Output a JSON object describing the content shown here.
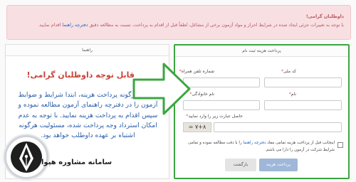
{
  "alert": {
    "title": "داوطلبان گرامی!",
    "text": "با توجه به تغییرات جزئی ایجاد شده در شرایط احراز و مواد آزمون برخی از مشاغل، لطفاً قبل از اقدام به پرداخت، نسبت به مطالعه دقیق",
    "link": "دفترچه راهنما",
    "text_end": "اقدام نمایید."
  },
  "guide_panel": {
    "header": "راهنما",
    "title": "قابل توجه داوطلبان گرامی!",
    "body": "قبل از هرگونه پرداخت هزینه، ابتدا شرایط و ضوابط آزمون را در دفترچه راهنمای آزمون مطالعه نموده و سپس اقدام به پرداخت هزینه نمایید. با توجه به عدم امکان استرداد وجه پرداخت شده، مسئولیت هرگونه اشتباه بر عهده داوطلب خواهد بود."
  },
  "payment_form": {
    "header": "پرداخت هزینه ثبت نام",
    "national_code_label": "کد ملی",
    "mobile_label": "شماره تلفن همراه",
    "first_name_label": "نام",
    "last_name_label": "نام خانوادگی",
    "captcha_label": "حاصل عبارت زیر را وارد نمایید",
    "captcha_text": "۷+۸ = ",
    "agreement_text_start": "اینجانب قبل از پرداخت هزینه تمامی مفاد",
    "agreement_link": "دفترچه راهنما",
    "agreement_text_end": "را با دقت مطالعه نموده و تمامی شرایط شرکت در آزمون را دارا می باشم.",
    "pay_button": "پرداخت هزینه",
    "back_button": "بازگشت"
  },
  "watermark": {
    "text": "سامانه مشاوره هپوا"
  },
  "colors": {
    "alert_bg": "#f8dfe2",
    "alert_text": "#b9545d",
    "highlight_border": "#3ca640",
    "guide_title": "#c8453b",
    "guide_body": "#2a5fab",
    "pay_button_bg": "#9fb7d8"
  }
}
